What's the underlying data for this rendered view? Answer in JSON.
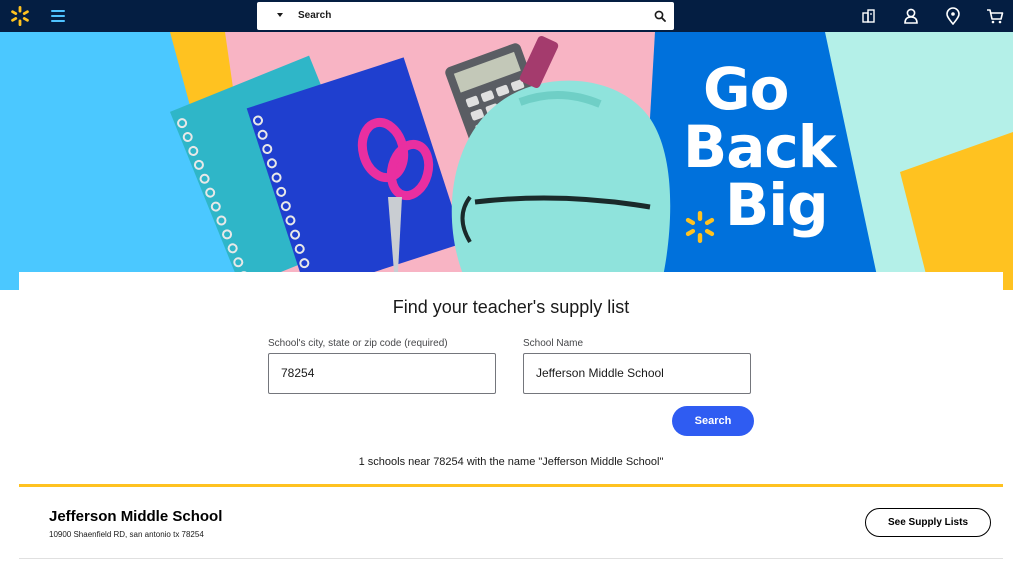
{
  "header": {
    "search_placeholder": "Search"
  },
  "hero": {
    "headline": [
      "Go",
      "Back",
      "Big"
    ],
    "colors": {
      "brand_blue": "#0071dc",
      "yellow": "#ffc220",
      "sky": "#4bc8ff"
    }
  },
  "form": {
    "title": "Find your teacher's supply list",
    "location_label": "School's city, state or zip code (required)",
    "location_value": "78254",
    "school_label": "School Name",
    "school_value": "Jefferson Middle School",
    "search_button": "Search",
    "results_message": "1 schools near 78254 with the name \"Jefferson Middle School\""
  },
  "results": [
    {
      "name": "Jefferson Middle School",
      "address": "10900 Shaenfield RD, san antonio tx 78254",
      "action_label": "See Supply Lists"
    }
  ],
  "icons": {
    "logo": "walmart-spark-icon",
    "menu": "hamburger-menu-icon",
    "search": "search-icon",
    "reorder": "reorder-icon",
    "account": "account-icon",
    "store": "location-pin-icon",
    "cart": "cart-icon"
  },
  "colors": {
    "topbar": "#041e42",
    "accent_blue": "#2f5cf2",
    "divider_yellow": "#ffc220"
  }
}
